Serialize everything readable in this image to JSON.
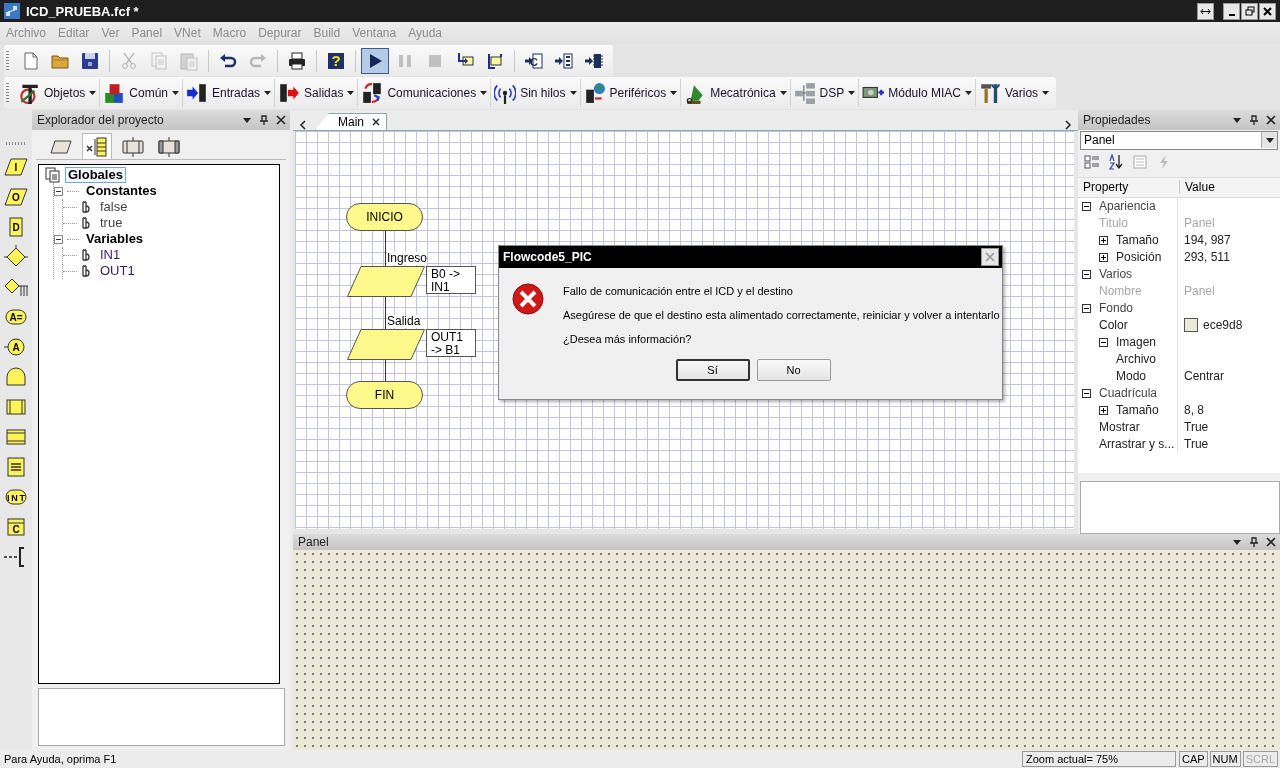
{
  "window": {
    "title": "ICD_PRUEBA.fcf *"
  },
  "menu": [
    {
      "label": "Archivo",
      "disabled": true
    },
    {
      "label": "Editar",
      "disabled": true
    },
    {
      "label": "Ver",
      "disabled": true
    },
    {
      "label": "Panel",
      "disabled": true
    },
    {
      "label": "VNet",
      "disabled": true
    },
    {
      "label": "Macro",
      "disabled": true
    },
    {
      "label": "Depurar",
      "disabled": true
    },
    {
      "label": "Build",
      "disabled": true
    },
    {
      "label": "Ventana",
      "disabled": true
    },
    {
      "label": "Ayuda",
      "disabled": true
    }
  ],
  "toolbar": [
    {
      "pressed": false,
      "disabled": false
    },
    {
      "pressed": false,
      "disabled": false
    },
    {
      "pressed": false,
      "disabled": false
    },
    {
      "pressed": false,
      "disabled": true
    },
    {
      "pressed": false,
      "disabled": true
    },
    {
      "pressed": false,
      "disabled": true
    },
    {
      "pressed": false,
      "disabled": false
    },
    {
      "pressed": false,
      "disabled": true
    },
    {
      "pressed": false,
      "disabled": false
    },
    {
      "pressed": false,
      "disabled": false,
      "glyph": "?"
    },
    {
      "pressed": true,
      "disabled": false
    },
    {
      "pressed": false,
      "disabled": true
    },
    {
      "pressed": false,
      "disabled": true
    },
    {
      "pressed": false,
      "disabled": false
    },
    {
      "pressed": false,
      "disabled": false
    },
    {
      "pressed": false,
      "disabled": false,
      "glyph": "C"
    },
    {
      "pressed": false,
      "disabled": false
    },
    {
      "pressed": false,
      "disabled": false
    }
  ],
  "component_toolbar": [
    {
      "label": "Objetos"
    },
    {
      "label": "Común"
    },
    {
      "label": "Entradas"
    },
    {
      "label": "Salidas"
    },
    {
      "label": "Comunicaciones"
    },
    {
      "label": "Sin hilos"
    },
    {
      "label": "Periféricos"
    },
    {
      "label": "Mecatrónica"
    },
    {
      "label": "DSP"
    },
    {
      "label": "Módulo MIAC"
    },
    {
      "label": "Varios"
    }
  ],
  "palette": [
    {
      "kind": "input",
      "label": "I"
    },
    {
      "kind": "output",
      "label": "O"
    },
    {
      "kind": "delay",
      "label": "D"
    },
    {
      "kind": "decision"
    },
    {
      "kind": "switch"
    },
    {
      "kind": "calculation",
      "label": "A="
    },
    {
      "kind": "connection",
      "label": "A"
    },
    {
      "kind": "loop"
    },
    {
      "kind": "macro"
    },
    {
      "kind": "component"
    },
    {
      "kind": "lines"
    },
    {
      "kind": "interrupt",
      "label": "INT"
    },
    {
      "kind": "code",
      "label": "C"
    },
    {
      "kind": "comment"
    }
  ],
  "explorer": {
    "title": "Explorador del proyecto",
    "tabs": [
      {
        "selected": false
      },
      {
        "selected": true
      },
      {
        "selected": false
      },
      {
        "selected": false
      }
    ],
    "tree": [
      {
        "label": "Globales",
        "kind": "root",
        "selected": true,
        "children": [
          {
            "label": "Constantes",
            "kind": "group",
            "expanded": true,
            "selected": false,
            "children": [
              {
                "label": "false",
                "kind": "constant",
                "selected": false
              },
              {
                "label": "true",
                "kind": "constant",
                "selected": false
              }
            ]
          },
          {
            "label": "Variables",
            "kind": "group",
            "expanded": true,
            "selected": false,
            "children": [
              {
                "label": "IN1",
                "kind": "variable",
                "selected": false
              },
              {
                "label": "OUT1",
                "kind": "variable",
                "selected": false
              }
            ]
          }
        ]
      }
    ]
  },
  "editor": {
    "tabs": [
      {
        "label": "Main",
        "selected": true
      }
    ],
    "flowchart": [
      {
        "kind": "terminator",
        "text": "INICIO"
      },
      {
        "kind": "input",
        "label": "Ingreso",
        "note": "B0 ->\nIN1"
      },
      {
        "kind": "output",
        "label": "Salida",
        "note": "OUT1\n-> B1"
      },
      {
        "kind": "terminator",
        "text": "FIN"
      }
    ]
  },
  "properties": {
    "title": "Propiedades",
    "object": "Panel",
    "columns": [
      "Property",
      "Value"
    ],
    "rows": [
      {
        "label": "Apariencia",
        "expanded": true,
        "disabled": false,
        "children": [
          {
            "label": "Titulo",
            "value": "Panel",
            "disabled": true
          },
          {
            "label": "Tamaño",
            "value": "194, 987",
            "expanded": false,
            "disabled": false
          },
          {
            "label": "Posición",
            "value": "293, 511",
            "expanded": false,
            "disabled": false
          }
        ]
      },
      {
        "label": "Varios",
        "expanded": true,
        "disabled": false,
        "children": [
          {
            "label": "Nombre",
            "value": "Panel",
            "disabled": true
          }
        ]
      },
      {
        "label": "Fondo",
        "expanded": true,
        "disabled": false,
        "children": [
          {
            "label": "Color",
            "value": "ece9d8",
            "color": "#ece9d8",
            "disabled": false
          },
          {
            "label": "Imagen",
            "expanded": true,
            "disabled": false,
            "children": [
              {
                "label": "Archivo",
                "disabled": false
              },
              {
                "label": "Modo",
                "value": "Centrar",
                "disabled": false
              }
            ]
          }
        ]
      },
      {
        "label": "Cuadrícula",
        "expanded": true,
        "disabled": false,
        "children": [
          {
            "label": "Tamaño",
            "value": "8, 8",
            "expanded": false,
            "disabled": false
          },
          {
            "label": "Mostrar",
            "value": "True",
            "disabled": false
          },
          {
            "label": "Arrastrar y s...",
            "value": "True",
            "disabled": false
          }
        ]
      }
    ]
  },
  "panel": {
    "title": "Panel"
  },
  "status_bar": {
    "help": "Para Ayuda, oprima F1",
    "zoom": "Zoom actual= 75%",
    "indicators": [
      {
        "label": "CAP",
        "disabled": false
      },
      {
        "label": "NUM",
        "disabled": false
      },
      {
        "label": "SCRL",
        "disabled": true
      }
    ]
  },
  "dialog": {
    "title": "Flowcode5_PIC",
    "messages": [
      "Fallo de comunicación entre el ICD y el destino",
      "Asegúrese de que el destino esta alimentado correctamente, reiniciar y volver a intentarlo",
      "¿Desea más información?"
    ],
    "buttons": [
      {
        "label": "Sí",
        "selected": true
      },
      {
        "label": "No",
        "selected": false
      }
    ]
  }
}
